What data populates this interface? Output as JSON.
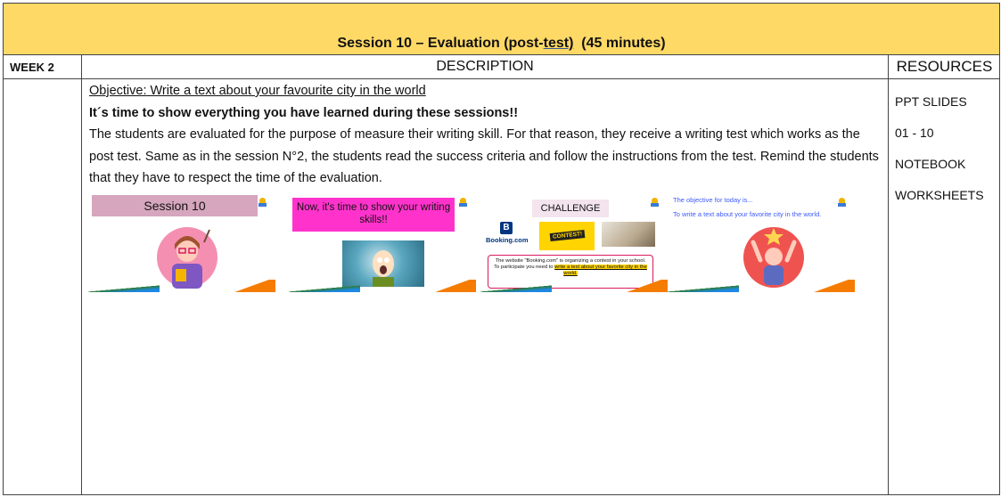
{
  "title": {
    "prefix": "Session 10 – Evaluation (post-",
    "underlined": "test)",
    "suffix": "  (45 minutes)"
  },
  "headers": {
    "week": "WEEK 2",
    "description": "DESCRIPTION",
    "resources": "RESOURCES"
  },
  "description": {
    "objective": "Objective: Write a text about your favourite city in the world",
    "headline": "It´s time to show everything you have learned during these sessions!!",
    "paragraph": "The students are evaluated for the purpose of measure their writing skill. For that reason, they receive a writing test which works as the post test. Same as in the session N°2, the students read the success criteria and follow the instructions from the test. Remind the students that they have to respect the time of the evaluation."
  },
  "slides": {
    "s1": {
      "banner": "Session 10"
    },
    "s2": {
      "banner": "Now, it's time to show your writing skills!!"
    },
    "s3": {
      "banner": "CHALLENGE",
      "booking_letter": "B",
      "booking_name": "Booking.com",
      "contest_tag": "CONTEST!",
      "text_start": "The website \"Booking.com\" is organizing a contest in your school. To participate you need to ",
      "text_highlight": "write a text about your favorite city in the world."
    },
    "s4": {
      "line1": "The objective for today is...",
      "line2": "To write a text about your favorite city in the world."
    }
  },
  "resources": [
    "PPT SLIDES",
    "01 - 10",
    "NOTEBOOK",
    "WORKSHEETS"
  ],
  "colors": {
    "title_band": "#ffd966",
    "slide1_banner": "#d5a6bd",
    "slide2_banner": "#ff33cc",
    "slide3_contest": "#ffd400",
    "slide3_box_border": "#d81b60",
    "slide4_text": "#3d5afe",
    "footer_green": "#2e7d32",
    "footer_orange": "#f57c00"
  }
}
